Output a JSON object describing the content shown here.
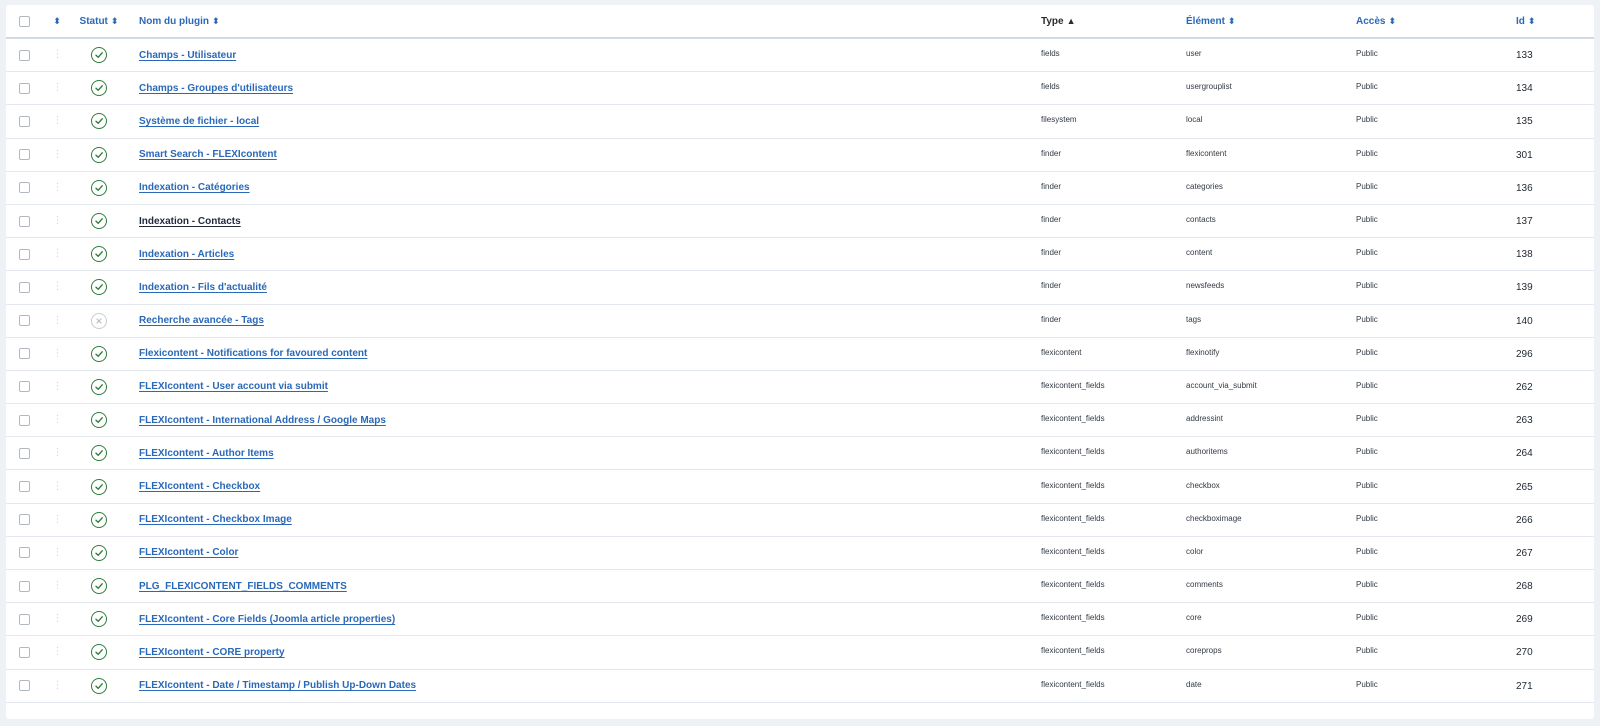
{
  "header": {
    "status": "Statut",
    "name": "Nom du plugin",
    "type": "Type",
    "element": "Élément",
    "access": "Accès",
    "id": "Id",
    "sort_icon": "⬍",
    "sort_asc_icon": "▲"
  },
  "colors": {
    "link": "#2a69b8",
    "enabled": "#2f7d3a",
    "disabled": "#c9ccd1"
  },
  "rows": [
    {
      "name": "Champs - Utilisateur",
      "enabled": true,
      "type": "fields",
      "element": "user",
      "access": "Public",
      "id": "133"
    },
    {
      "name": "Champs - Groupes d'utilisateurs",
      "enabled": true,
      "type": "fields",
      "element": "usergrouplist",
      "access": "Public",
      "id": "134"
    },
    {
      "name": "Système de fichier - local",
      "enabled": true,
      "type": "filesystem",
      "element": "local",
      "access": "Public",
      "id": "135"
    },
    {
      "name": "Smart Search - FLEXIcontent",
      "enabled": true,
      "type": "finder",
      "element": "flexicontent",
      "access": "Public",
      "id": "301"
    },
    {
      "name": "Indexation - Catégories",
      "enabled": true,
      "type": "finder",
      "element": "categories",
      "access": "Public",
      "id": "136"
    },
    {
      "name": "Indexation - Contacts",
      "enabled": true,
      "dark": true,
      "type": "finder",
      "element": "contacts",
      "access": "Public",
      "id": "137"
    },
    {
      "name": "Indexation - Articles",
      "enabled": true,
      "type": "finder",
      "element": "content",
      "access": "Public",
      "id": "138"
    },
    {
      "name": "Indexation - Fils d'actualité",
      "enabled": true,
      "type": "finder",
      "element": "newsfeeds",
      "access": "Public",
      "id": "139"
    },
    {
      "name": "Recherche avancée - Tags",
      "enabled": false,
      "type": "finder",
      "element": "tags",
      "access": "Public",
      "id": "140"
    },
    {
      "name": "Flexicontent - Notifications for favoured content",
      "enabled": true,
      "type": "flexicontent",
      "element": "flexinotify",
      "access": "Public",
      "id": "296"
    },
    {
      "name": "FLEXIcontent - User account via submit",
      "enabled": true,
      "type": "flexicontent_fields",
      "element": "account_via_submit",
      "access": "Public",
      "id": "262"
    },
    {
      "name": "FLEXIcontent - International Address / Google Maps",
      "enabled": true,
      "type": "flexicontent_fields",
      "element": "addressint",
      "access": "Public",
      "id": "263"
    },
    {
      "name": "FLEXIcontent - Author Items",
      "enabled": true,
      "type": "flexicontent_fields",
      "element": "authoritems",
      "access": "Public",
      "id": "264"
    },
    {
      "name": "FLEXIcontent - Checkbox",
      "enabled": true,
      "type": "flexicontent_fields",
      "element": "checkbox",
      "access": "Public",
      "id": "265"
    },
    {
      "name": "FLEXIcontent - Checkbox Image",
      "enabled": true,
      "type": "flexicontent_fields",
      "element": "checkboximage",
      "access": "Public",
      "id": "266"
    },
    {
      "name": "FLEXIcontent - Color",
      "enabled": true,
      "type": "flexicontent_fields",
      "element": "color",
      "access": "Public",
      "id": "267"
    },
    {
      "name": "PLG_FLEXICONTENT_FIELDS_COMMENTS",
      "enabled": true,
      "type": "flexicontent_fields",
      "element": "comments",
      "access": "Public",
      "id": "268"
    },
    {
      "name": "FLEXIcontent - Core Fields (Joomla article properties)",
      "enabled": true,
      "type": "flexicontent_fields",
      "element": "core",
      "access": "Public",
      "id": "269"
    },
    {
      "name": "FLEXIcontent - CORE property",
      "enabled": true,
      "type": "flexicontent_fields",
      "element": "coreprops",
      "access": "Public",
      "id": "270"
    },
    {
      "name": "FLEXIcontent - Date / Timestamp / Publish Up-Down Dates",
      "enabled": true,
      "type": "flexicontent_fields",
      "element": "date",
      "access": "Public",
      "id": "271"
    }
  ]
}
